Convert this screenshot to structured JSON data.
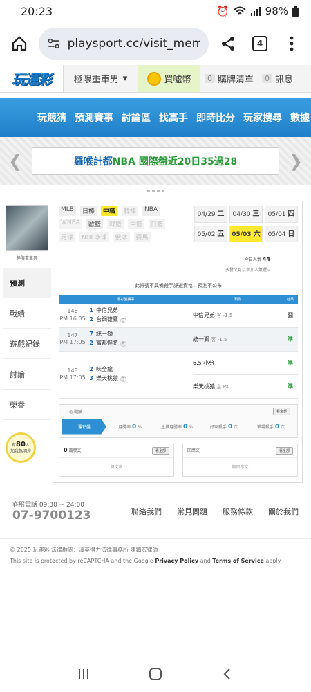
{
  "status_bar": {
    "time": "20:23",
    "battery": "98%"
  },
  "browser": {
    "url": "playsport.cc/visit_mem",
    "tab_count": "4"
  },
  "site": {
    "logo_text": "玩運彩",
    "user_name": "極限重車男",
    "coin_label": "買噓幣",
    "cart_count": "0",
    "cart_label": "購牌清單",
    "msg_count": "0",
    "msg_label": "訊息"
  },
  "menu": [
    "玩競猜",
    "預測賽事",
    "討論區",
    "找高手",
    "即時比分",
    "玩家搜尋",
    "數據"
  ],
  "promo": {
    "text_a": "羅喉計都 ",
    "text_b": "NBA 國際盤近20日35過28"
  },
  "sidebar": {
    "avatar_name": "極限重車男",
    "items": [
      "預測",
      "戰績",
      "遊戲紀錄",
      "討論",
      "榮譽"
    ],
    "bulb_count": "80",
    "bulb_prefix": "有",
    "bulb_suffix": "人",
    "bulb_caption": "加我為明燈"
  },
  "leagues": [
    {
      "label": "MLB",
      "state": "normal"
    },
    {
      "label": "日棒",
      "state": "normal"
    },
    {
      "label": "中職",
      "state": "active"
    },
    {
      "label": "韓棒",
      "state": "off"
    },
    {
      "label": "NBA",
      "state": "normal"
    },
    {
      "label": "WNBA",
      "state": "off"
    },
    {
      "label": "歐籃",
      "state": "normal"
    },
    {
      "label": "韓籃",
      "state": "off"
    },
    {
      "label": "中籃",
      "state": "off"
    },
    {
      "label": "日籃",
      "state": "off"
    },
    {
      "label": "足球",
      "state": "off"
    },
    {
      "label": "NHL冰球",
      "state": "off"
    },
    {
      "label": "俄冰",
      "state": "off"
    },
    {
      "label": "賽馬",
      "state": "off"
    }
  ],
  "dates": [
    {
      "md": "04/29",
      "wd": "二",
      "active": false
    },
    {
      "md": "04/30",
      "wd": "三",
      "active": false
    },
    {
      "md": "05/01",
      "wd": "四",
      "active": false
    },
    {
      "md": "05/02",
      "wd": "五",
      "active": false
    },
    {
      "md": "05/03",
      "wd": "六",
      "active": true
    },
    {
      "md": "05/04",
      "wd": "日",
      "active": false
    }
  ],
  "popularity": {
    "label": "今日人氣",
    "value": "44",
    "tip": "多發文可以增加人氣喔~"
  },
  "notice": "此帳號不具備殺手評選資格，預測不公布",
  "table": {
    "headers": [
      "選彩盤賽事",
      "預測",
      "結果"
    ],
    "games": [
      {
        "num": "146",
        "time": "PM 16:05",
        "away_score": "1",
        "away": "中信兄弟",
        "home_score": "2",
        "home": "台鋼雄鷹",
        "home_tag": "主",
        "picks": [
          {
            "text": "中信兄弟",
            "sub": "客 -1.5",
            "result": "囧",
            "win": false
          }
        ]
      },
      {
        "num": "147",
        "time": "PM 17:05",
        "away_score": "7",
        "away": "統一獅",
        "home_score": "2",
        "home": "富邦悍將",
        "home_tag": "主",
        "picks": [
          {
            "text": "統一獅",
            "sub": "客 -1.5",
            "result": "準",
            "win": true
          }
        ]
      },
      {
        "num": "148",
        "time": "PM 17:05",
        "away_score": "2",
        "away": "味全龍",
        "home_score": "3",
        "home": "樂天桃猿",
        "home_tag": "主",
        "picks": [
          {
            "text": "6.5 小分",
            "sub": "",
            "result": "準",
            "win": true
          },
          {
            "text": "樂天桃猿",
            "sub": "主 PK",
            "result": "準",
            "win": true
          }
        ]
      }
    ]
  },
  "record": {
    "title": "戰績",
    "see_all": "看全部",
    "tab": "運彩盤",
    "stats": [
      {
        "label": "月勝率",
        "value": "0",
        "unit": "%"
      },
      {
        "label": "主推月勝率",
        "value": "0",
        "unit": "%"
      },
      {
        "label": "好家殺手",
        "value": "0",
        "unit": "次"
      },
      {
        "label": "單場殺手",
        "value": "0",
        "unit": "次"
      }
    ]
  },
  "posts": {
    "left_count": "0",
    "left_label": "篇發文",
    "left_see_all": "看全部",
    "left_empty": "無文章",
    "right_label": "回應文",
    "right_see_all": "看全部",
    "right_empty": "無回應文"
  },
  "footer": {
    "hotline_label": "客服電話 09:30 ~ 24:00",
    "hotline": "07-9700123",
    "links": [
      "聯絡我們",
      "常見問題",
      "服務條款",
      "關於我們"
    ],
    "copyright": "© 2025 玩運彩  法律顧問：漢英得力法律事務所 陳鎮宏律師",
    "recaptcha_prefix": "This site is protected by reCAPTCHA and the Google ",
    "privacy": "Privacy Policy",
    "and": " and ",
    "terms": "Terms of Service",
    "apply": " apply."
  }
}
